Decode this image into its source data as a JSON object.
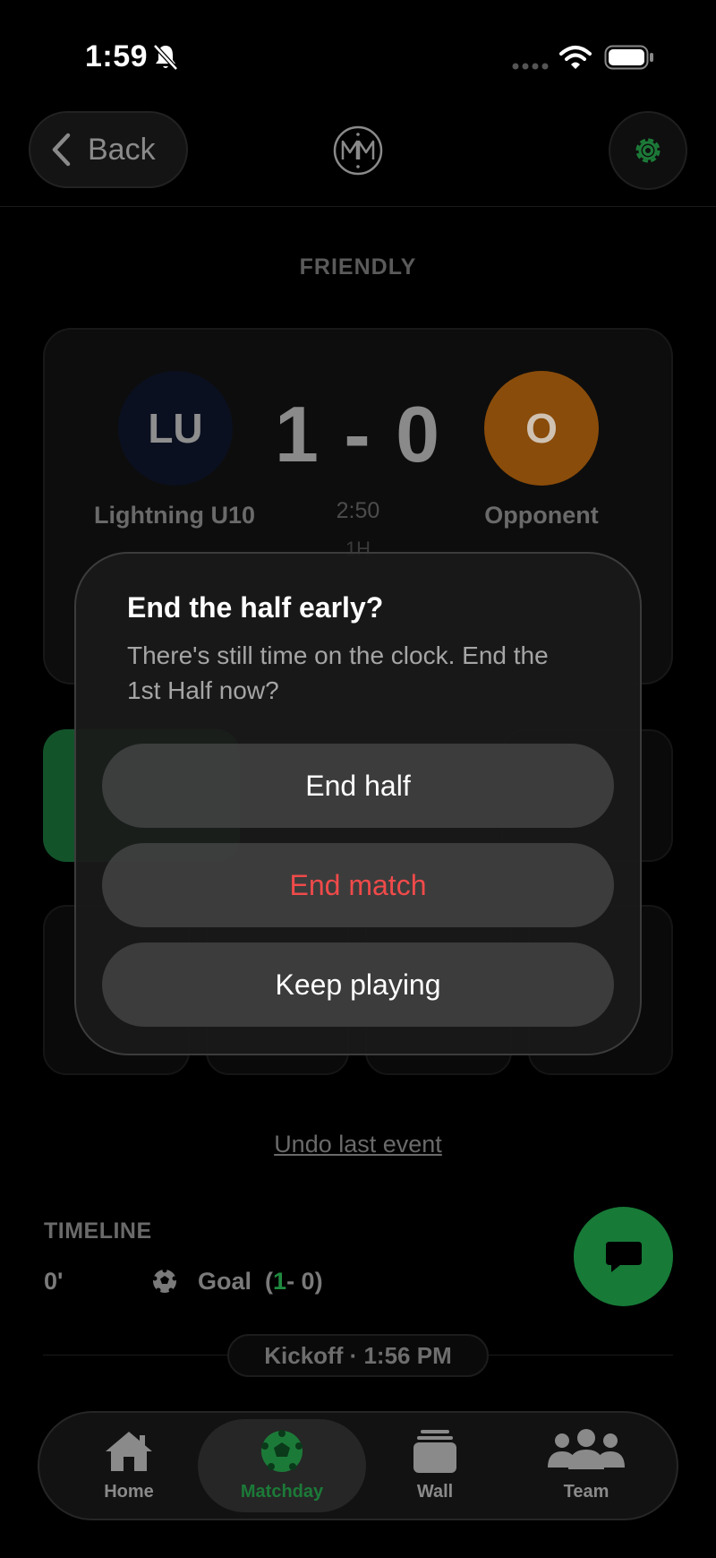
{
  "status_bar": {
    "time": "1:59"
  },
  "header": {
    "back_label": "Back"
  },
  "match": {
    "type": "FRIENDLY",
    "home": {
      "initials": "LU",
      "name": "Lightning U10",
      "color": "#0b1020"
    },
    "away": {
      "initials": "O",
      "name": "Opponent",
      "color": "#8a4c0a"
    },
    "score": "1 - 0",
    "clock": "2:50",
    "period": "1H"
  },
  "undo_label": "Undo last event",
  "timeline": {
    "title": "TIMELINE",
    "events": [
      {
        "minute": "0'",
        "type": "Goal",
        "score_open": "(",
        "score_home": "1",
        "score_rest": " - 0)"
      }
    ],
    "kickoff": "Kickoff · 1:56 PM"
  },
  "tabs": [
    {
      "label": "Home",
      "icon": "house-icon"
    },
    {
      "label": "Matchday",
      "icon": "soccer-ball-icon",
      "active": true
    },
    {
      "label": "Wall",
      "icon": "stack-icon"
    },
    {
      "label": "Team",
      "icon": "people-icon"
    }
  ],
  "dialog": {
    "title": "End the half early?",
    "message": "There's still time on the clock. End the 1st Half now?",
    "buttons": {
      "end_half": "End half",
      "end_match": "End match",
      "keep_playing": "Keep playing"
    }
  },
  "colors": {
    "accent_green": "#177a37",
    "destructive_red": "#f04a4a"
  }
}
